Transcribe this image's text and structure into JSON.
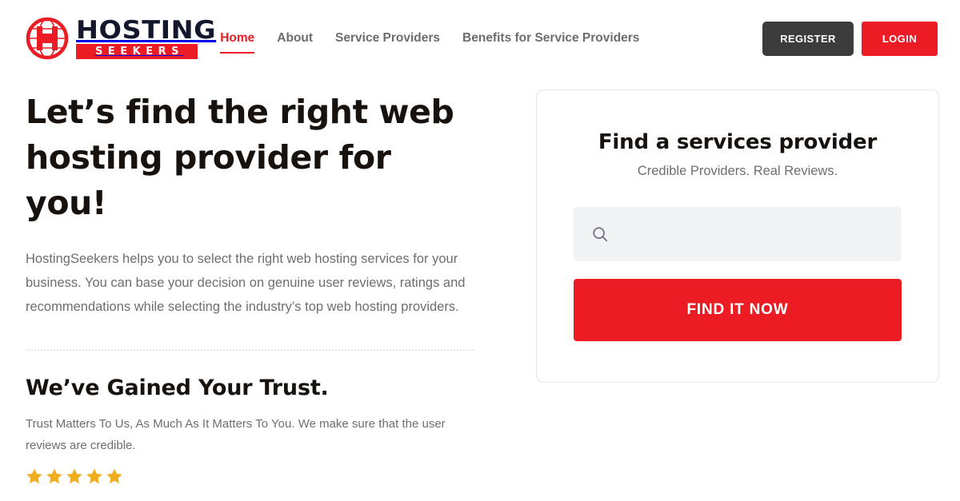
{
  "brand": {
    "logo_icon": "globe-h-logo-icon",
    "name_primary": "HOSTING",
    "name_secondary": "SEEKERS",
    "colors": {
      "red": "#ec1c24",
      "navy": "#14182c",
      "dark": "#3c3c3c",
      "star_gold": "#f0ad1e"
    }
  },
  "nav": {
    "items": [
      {
        "label": "Home",
        "active": true
      },
      {
        "label": "About",
        "active": false
      },
      {
        "label": "Service Providers",
        "active": false
      },
      {
        "label": "Benefits for Service Providers",
        "active": false
      }
    ]
  },
  "header_actions": {
    "register_label": "REGISTER",
    "login_label": "LOGIN"
  },
  "hero": {
    "title": "Let’s find the right web hosting provider for you!",
    "body": "HostingSeekers helps you to select the right web hosting services for your business. You can base your decision on genuine user reviews, ratings and recommendations while selecting the industry’s top web hosting providers."
  },
  "trust": {
    "title": "We’ve Gained Your Trust.",
    "body": "Trust Matters To Us, As Much As It Matters To You. We make sure that the user reviews are credible.",
    "rating": 5,
    "star_icon": "star-filled-icon"
  },
  "search_card": {
    "title": "Find a services provider",
    "subtitle": "Credible Providers. Real Reviews.",
    "search_icon": "search-icon",
    "search_value": "",
    "search_placeholder": "",
    "submit_label": "FIND IT NOW"
  }
}
